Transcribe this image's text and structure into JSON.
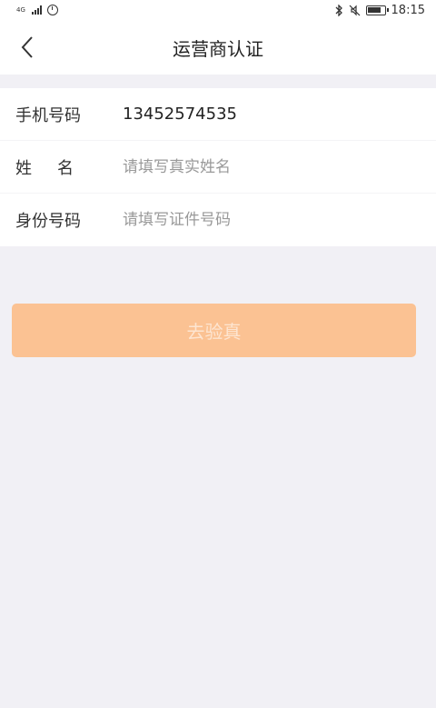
{
  "status_bar": {
    "network_label": "4G",
    "time": "18:15",
    "icons": [
      "signal-icon",
      "alarm-icon",
      "bluetooth-icon",
      "mute-icon",
      "battery-icon"
    ]
  },
  "header": {
    "title": "运营商认证",
    "back_icon": "chevron-left-icon"
  },
  "form": {
    "phone": {
      "label": "手机号码",
      "value": "13452574535"
    },
    "name": {
      "label": "姓名",
      "placeholder": "请填写真实姓名"
    },
    "id_number": {
      "label": "身份号码",
      "placeholder": "请填写证件号码"
    }
  },
  "verify_button": {
    "label": "去验真"
  },
  "colors": {
    "background": "#f1f0f5",
    "button_bg": "#fbc293",
    "button_text": "#fde5d1"
  }
}
